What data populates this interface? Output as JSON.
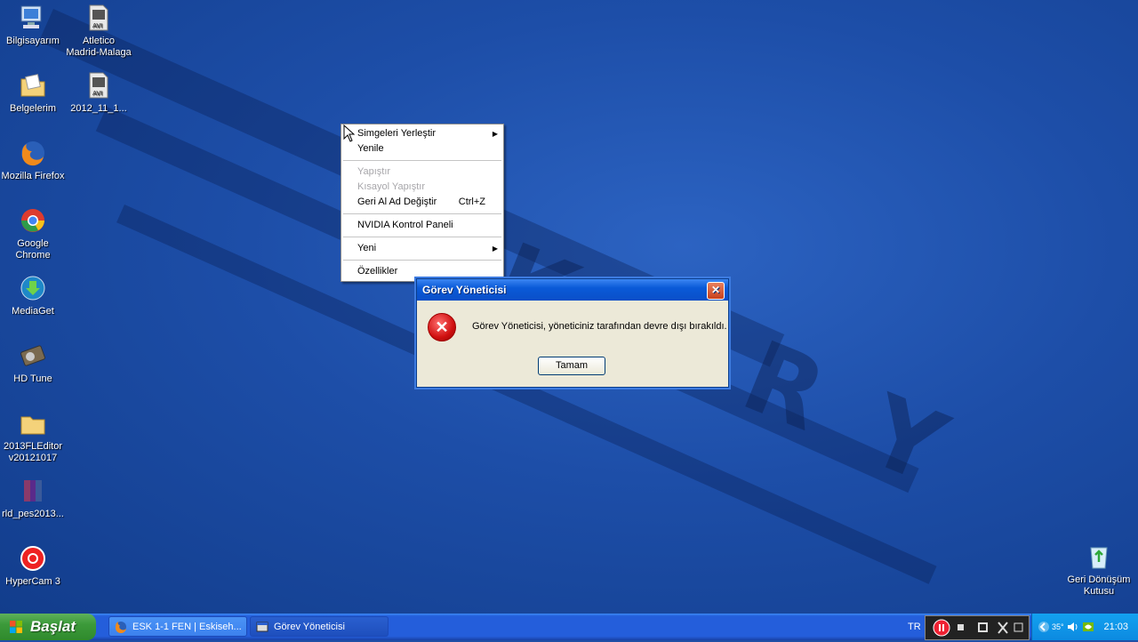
{
  "desktop": {
    "icons": [
      {
        "label": "Bilgisayarım",
        "icon": "computer-icon"
      },
      {
        "label": "Atletico Madrid-Malaga",
        "icon": "avi-file-icon"
      },
      {
        "label": "Belgelerim",
        "icon": "documents-folder-icon"
      },
      {
        "label": "2012_11_1...",
        "icon": "avi-file-icon"
      },
      {
        "label": "Mozilla Firefox",
        "icon": "firefox-icon"
      },
      {
        "label": "Google Chrome",
        "icon": "chrome-icon"
      },
      {
        "label": "MediaGet",
        "icon": "mediaget-icon"
      },
      {
        "label": "HD Tune",
        "icon": "hdtune-icon"
      },
      {
        "label": "2013FLEditor v20121017",
        "icon": "folder-icon"
      },
      {
        "label": "rld_pes2013...",
        "icon": "archive-icon"
      },
      {
        "label": "HyperCam 3",
        "icon": "hypercam-icon"
      },
      {
        "label": "Geri Dönüşüm Kutusu",
        "icon": "recycle-bin-icon"
      }
    ]
  },
  "context_menu": {
    "items": [
      {
        "label": "Simgeleri Yerleştir",
        "submenu": true,
        "disabled": false
      },
      {
        "label": "Yenile",
        "submenu": false,
        "disabled": false
      },
      {
        "label": "Yapıştır",
        "submenu": false,
        "disabled": true
      },
      {
        "label": "Kısayol Yapıştır",
        "submenu": false,
        "disabled": true
      },
      {
        "label": "Geri Al Ad Değiştir",
        "shortcut": "Ctrl+Z",
        "submenu": false,
        "disabled": false
      },
      {
        "label": "NVIDIA Kontrol Paneli",
        "submenu": false,
        "disabled": false
      },
      {
        "label": "Yeni",
        "submenu": true,
        "disabled": false
      },
      {
        "label": "Özellikler",
        "submenu": false,
        "disabled": false
      }
    ]
  },
  "dialog": {
    "title": "Görev Yöneticisi",
    "close_glyph": "✕",
    "error_glyph": "✕",
    "message": "Görev Yöneticisi, yöneticiniz tarafından devre dışı bırakıldı.",
    "ok_label": "Tamam"
  },
  "taskbar": {
    "start_label": "Başlat",
    "buttons": [
      {
        "label": "ESK 1-1 FEN | Eskiseh...",
        "icon": "firefox-icon"
      },
      {
        "label": "Görev Yöneticisi",
        "icon": "window-icon"
      }
    ],
    "language": "TR",
    "tray_temp": "35°",
    "clock": "21:03"
  },
  "colors": {
    "desktop_blue": "#1f4fa6",
    "taskbar_blue": "#245edb",
    "start_green": "#3c9a3a",
    "tray_blue": "#0c8ae0"
  }
}
